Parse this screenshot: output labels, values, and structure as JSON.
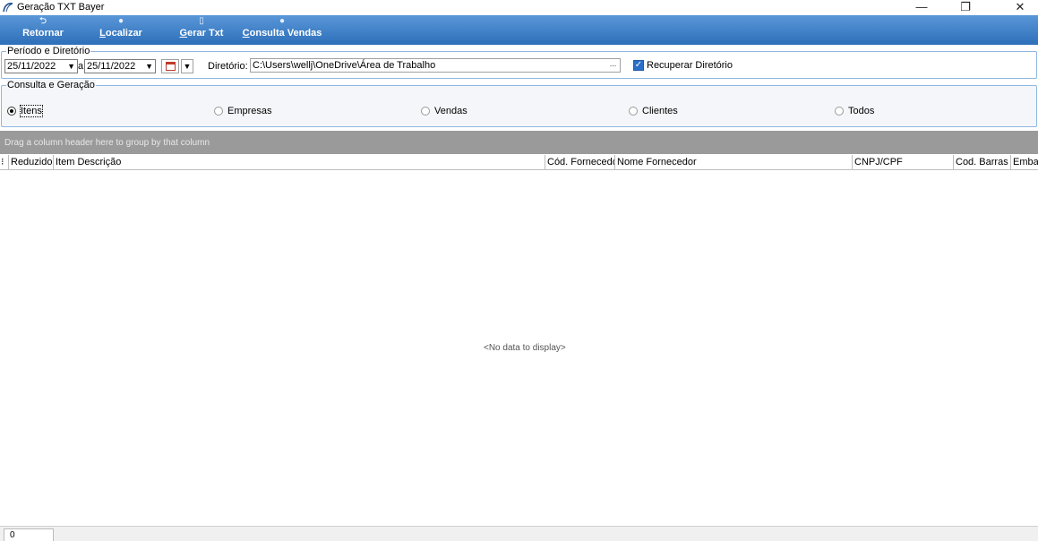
{
  "window": {
    "title": "Geração TXT Bayer",
    "minimize_icon": "—",
    "restore_icon": "❐",
    "close_icon": "✕"
  },
  "toolbar": {
    "retornar": {
      "label": "Retornar",
      "icon": "⮌"
    },
    "localizar": {
      "label_underline": "L",
      "label_rest": "ocalizar",
      "icon": "●"
    },
    "gerar": {
      "label_underline": "G",
      "label_rest": "erar Txt",
      "icon": "▯"
    },
    "consulta": {
      "label_underline": "C",
      "label_rest": "onsulta Vendas",
      "icon": "●"
    }
  },
  "periodo": {
    "legend": "Período e Diretório",
    "date_from": "25/11/2022",
    "separator": "a",
    "date_to": "25/11/2022",
    "dropdown_arrow": "▼",
    "dir_label": "Diretório:",
    "dir_value": "C:\\Users\\wellj\\OneDrive\\Área de Trabalho",
    "dir_button": "...",
    "recuperar_checked_mark": "✓",
    "recuperar_label": "Recuperar Diretório"
  },
  "consulta": {
    "legend": "Consulta e Geração",
    "options": [
      "Itens",
      "Empresas",
      "Vendas",
      "Clientes",
      "Todos"
    ],
    "selected": "Itens"
  },
  "grid": {
    "group_hint": "Drag a column header here to group by that column",
    "indicator": "⁝",
    "columns": [
      "Reduzido",
      "Item Descrição",
      "Cód. Fornecedor",
      "Nome Fornecedor",
      "CNPJ/CPF",
      "Cod. Barras",
      "Embal"
    ],
    "empty_text": "<No data to display>"
  },
  "status": {
    "count": "0"
  }
}
